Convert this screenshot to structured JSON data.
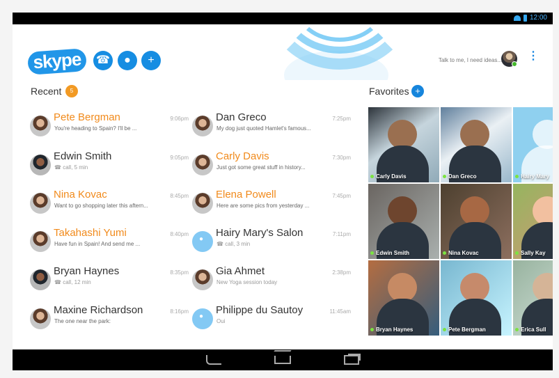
{
  "status_bar": {
    "time": "12:00"
  },
  "app": {
    "logo_text": "skype",
    "actions": {
      "call_icon": "phone-icon",
      "chat_icon": "chat-bubble-icon",
      "add_contact_icon": "add-person-icon"
    },
    "mood": "Talk to me, I need ideas...",
    "more_icon": "more-vertical-icon"
  },
  "recent": {
    "title": "Recent",
    "count": "5",
    "contacts": [
      {
        "name": "Pete Bergman",
        "message": "You're heading to Spain? I'll be ...",
        "time": "9:06pm"
      },
      {
        "name": "Edwin Smith",
        "message": "call, 5 min",
        "time": "9:05pm"
      },
      {
        "name": "Nina Kovac",
        "message": "Want to go shopping later this aftern...",
        "time": "8:45pm"
      },
      {
        "name": "Takahashi Yumi",
        "message": "Have fun in Spain! And send me ...",
        "time": "8:40pm"
      },
      {
        "name": "Bryan Haynes",
        "message": "call, 12 min",
        "time": "8:35pm"
      },
      {
        "name": "Maxine Richardson",
        "message": "The one near the park:",
        "time": "8:16pm"
      },
      {
        "name": "Dan Greco",
        "message": "My dog just quoted Hamlet's famous...",
        "time": "7:25pm"
      },
      {
        "name": "Carly Davis",
        "message": "Just got some great stuff in history...",
        "time": "7:30pm"
      },
      {
        "name": "Elena Powell",
        "message": "Here are some pics from yesterday ...",
        "time": "7:45pm"
      },
      {
        "name": "Hairy Mary's Salon",
        "message": "call, 3 min",
        "time": "7:11pm"
      },
      {
        "name": "Gia Ahmet",
        "message": "New Yoga session today",
        "time": "2:38pm"
      },
      {
        "name": "Philippe du Sautoy",
        "message": "Oui",
        "time": "11:45am"
      }
    ]
  },
  "favorites": {
    "title": "Favorites",
    "add_label": "+",
    "tiles": [
      {
        "name": "Carly Davis"
      },
      {
        "name": "Dan Greco"
      },
      {
        "name": "Hairy Mary"
      },
      {
        "name": "Edwin Smith"
      },
      {
        "name": "Nina Kovac"
      },
      {
        "name": "Sally Kay"
      },
      {
        "name": "Bryan Haynes"
      },
      {
        "name": "Pete Bergman"
      },
      {
        "name": "Erica Sull"
      }
    ]
  },
  "navigation": {
    "back_icon": "back-icon",
    "home_icon": "home-icon",
    "recent_apps_icon": "recent-apps-icon"
  }
}
